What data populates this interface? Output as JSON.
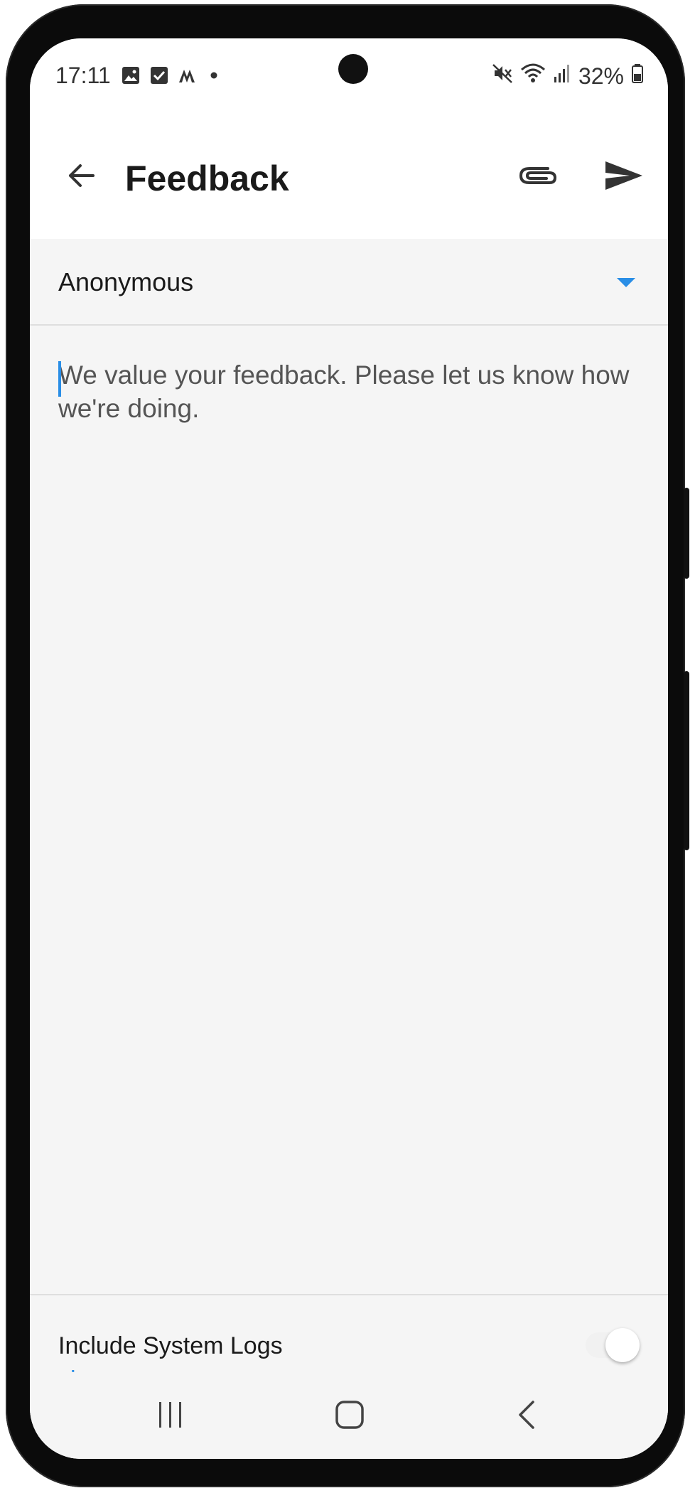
{
  "status_bar": {
    "time": "17:11",
    "battery": "32%",
    "icons_left": [
      "image-icon",
      "checkbox-icon",
      "app-icon",
      "dot-icon"
    ],
    "icons_right": [
      "mute-icon",
      "wifi-icon",
      "signal-icon",
      "battery-icon"
    ]
  },
  "app_bar": {
    "title": "Feedback",
    "back_icon": "arrow-left-icon",
    "attach_icon": "paperclip-icon",
    "send_icon": "send-icon"
  },
  "form": {
    "sender_value": "Anonymous",
    "feedback_placeholder": "We value your feedback. Please let us know how we're doing.",
    "logs_label": "Include System Logs",
    "logs_link": "view",
    "logs_toggle_on": false
  },
  "nav_bar": {
    "icons": [
      "recents-icon",
      "home-icon",
      "back-icon"
    ]
  },
  "colors": {
    "accent": "#2a8ee6",
    "background": "#f5f5f5",
    "app_bar": "#ffffff"
  }
}
